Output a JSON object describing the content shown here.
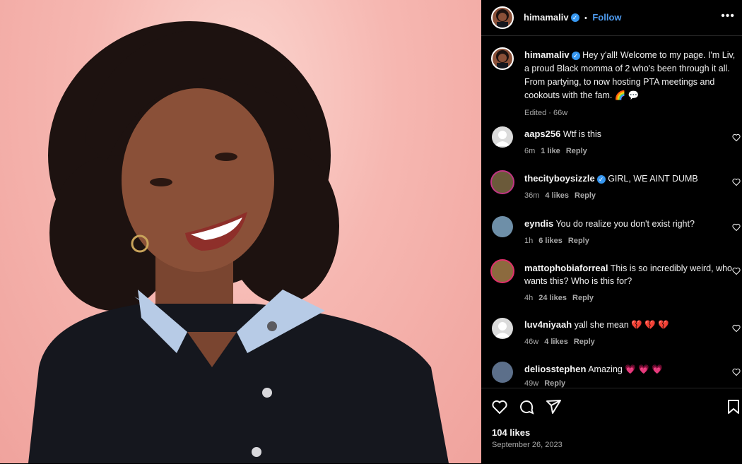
{
  "header": {
    "username": "himamaliv",
    "separator": "•",
    "follow_label": "Follow",
    "more": "•••"
  },
  "caption": {
    "username": "himamaliv",
    "text": "Hey y'all! Welcome to my page. I'm Liv, a proud Black momma of 2 who's been through it all. From partying, to now hosting PTA meetings and cookouts with the fam. 🌈 💬",
    "meta": "Edited · 66w"
  },
  "comments": [
    {
      "username": "aaps256",
      "text": "Wtf is this",
      "time": "6m",
      "likes": "1 like",
      "reply": "Reply"
    },
    {
      "username": "thecityboysizzle",
      "text": "GIRL, WE AINT DUMB",
      "time": "36m",
      "likes": "4 likes",
      "reply": "Reply"
    },
    {
      "username": "eyndis",
      "text": "You do realize you don't exist right?",
      "time": "1h",
      "likes": "6 likes",
      "reply": "Reply"
    },
    {
      "username": "mattophobiaforreal",
      "text": "This is so incredibly weird, who wants this? Who is this for?",
      "time": "4h",
      "likes": "24 likes",
      "reply": "Reply"
    },
    {
      "username": "luv4niyaah",
      "text": "yall she mean 💔 💔 💔",
      "time": "46w",
      "likes": "4 likes",
      "reply": "Reply"
    },
    {
      "username": "deliosstephen",
      "text": "Amazing 💗 💗 💗",
      "time": "49w",
      "likes": "",
      "reply": "Reply"
    }
  ],
  "footer": {
    "likes": "104 likes",
    "date": "September 26, 2023"
  },
  "colors": {
    "follow": "#4f9cf0",
    "verified": "#3797f0",
    "background": "#000000",
    "photo_bg": "#f6b7b1"
  },
  "icons": [
    "heart-icon",
    "comment-icon",
    "share-icon",
    "bookmark-icon",
    "more-icon",
    "verified-icon"
  ]
}
